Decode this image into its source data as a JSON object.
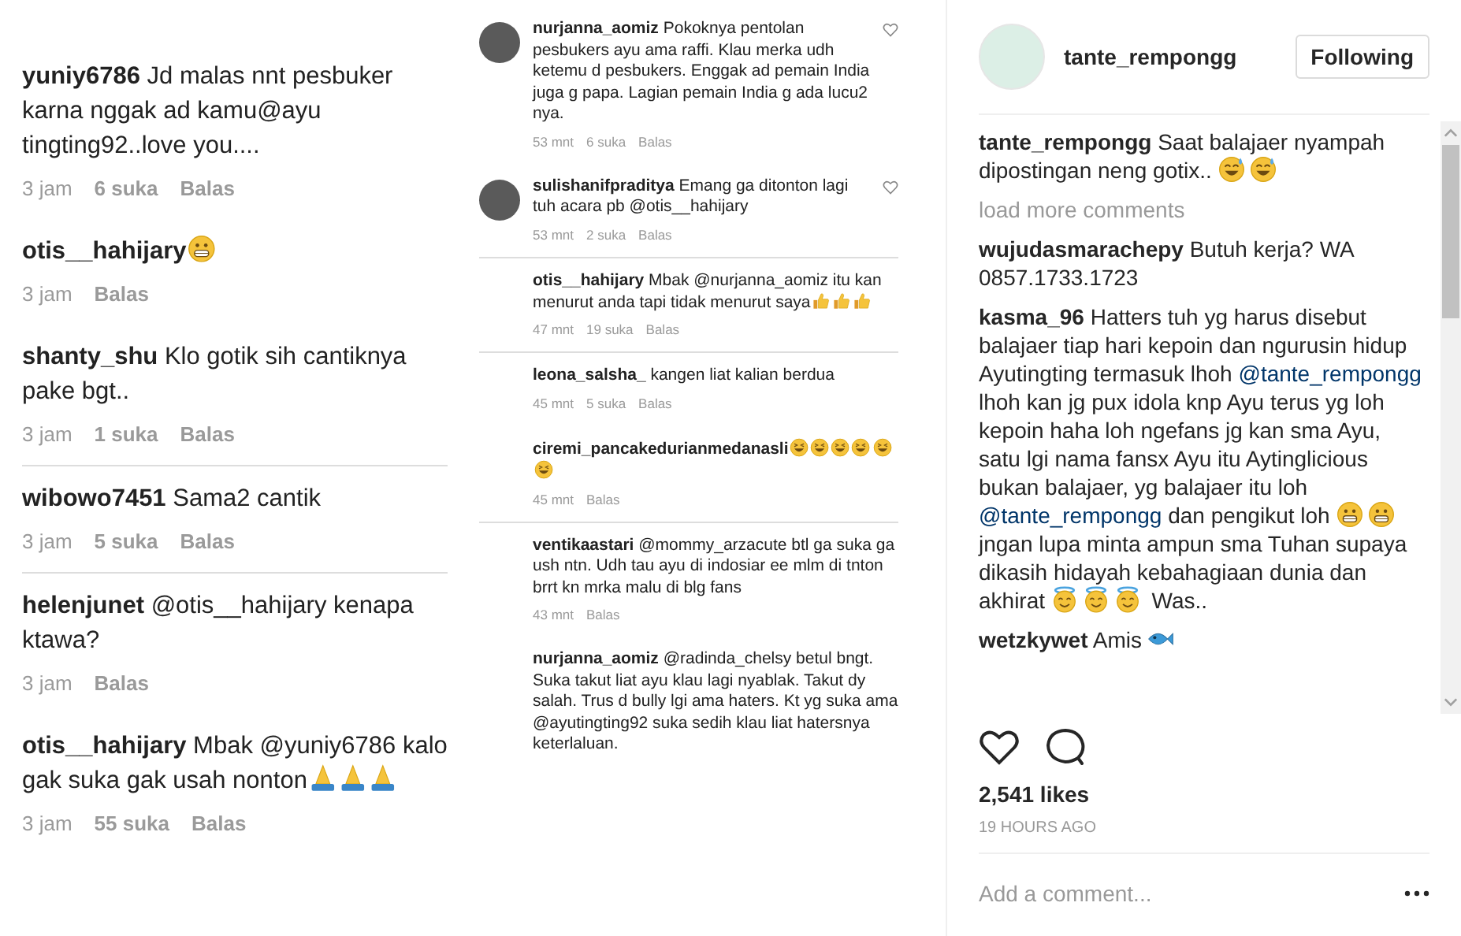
{
  "post_image": {
    "left_column": [
      {
        "text": "**yuniy6786** Jd malas nnt pesbuker karna nggak ad kamu@ayu tingting92..love you....",
        "meta": [
          "3 jam",
          "6 suka",
          "Balas"
        ],
        "divider": false
      },
      {
        "text": "**otis__hahijary**",
        "emoji": [
          {
            "kind": "grin"
          }
        ],
        "meta": [
          "3 jam",
          "Balas"
        ],
        "divider": false
      },
      {
        "text": "**shanty_shu** Klo gotik sih cantiknya pake bgt..",
        "meta": [
          "3 jam",
          "1 suka",
          "Balas"
        ],
        "divider": true
      },
      {
        "text": "**wibowo7451** Sama2 cantik",
        "meta": [
          "3 jam",
          "5 suka",
          "Balas"
        ],
        "divider": true
      },
      {
        "text": "**helenjunet** @otis__hahijary kenapa ktawa?",
        "meta": [
          "3 jam",
          "Balas"
        ],
        "divider": false
      },
      {
        "text": "**otis__hahijary** Mbak @yuniy6786 kalo gak suka gak usah nonton",
        "emoji": [
          {
            "kind": "pray"
          },
          {
            "kind": "pray"
          },
          {
            "kind": "pray"
          }
        ],
        "meta": [
          "3 jam",
          "55 suka",
          "Balas"
        ],
        "divider": false
      }
    ],
    "right_column": [
      {
        "avatar": true,
        "like_icon": true,
        "text": "**nurjanna_aomiz** Pokoknya pentolan pesbukers ayu ama raffi. Klau merka udh ketemu d pesbukers. Enggak ad pemain India juga g papa. Lagian pemain India g ada lucu2 nya.",
        "meta": [
          "53 mnt",
          "6 suka",
          "Balas"
        ],
        "divider": false
      },
      {
        "avatar": true,
        "like_icon": true,
        "text": "**sulishanifpraditya** Emang ga ditonton lagi tuh acara pb @otis__hahijary",
        "meta": [
          "53 mnt",
          "2 suka",
          "Balas"
        ],
        "divider": true
      },
      {
        "avatar": false,
        "like_icon": false,
        "text": "**otis__hahijary** Mbak @nurjanna_aomiz itu kan menurut anda tapi tidak menurut saya",
        "emoji": [
          {
            "kind": "thumb"
          },
          {
            "kind": "thumb"
          },
          {
            "kind": "thumb"
          }
        ],
        "meta": [
          "47 mnt",
          "19 suka",
          "Balas"
        ],
        "divider": true
      },
      {
        "avatar": false,
        "like_icon": false,
        "text": "**leona_salsha_** kangen liat kalian berdua",
        "meta": [
          "45 mnt",
          "5 suka",
          "Balas"
        ],
        "divider": false
      },
      {
        "avatar": false,
        "like_icon": false,
        "text": "**ciremi_pancakedurianmedanasli**",
        "emoji": [
          {
            "kind": "squint"
          },
          {
            "kind": "squint"
          },
          {
            "kind": "squint"
          },
          {
            "kind": "squint"
          },
          {
            "kind": "squint"
          },
          {
            "kind": "squint"
          }
        ],
        "meta": [
          "45 mnt",
          "Balas"
        ],
        "divider": true
      },
      {
        "avatar": false,
        "like_icon": false,
        "text": "**ventikaastari** @mommy_arzacute btl ga suka ga ush ntn. Udh tau ayu di indosiar ee mlm di tnton brrt kn mrka malu di blg fans",
        "meta": [
          "43 mnt",
          "Balas"
        ],
        "divider": false
      },
      {
        "avatar": false,
        "like_icon": false,
        "text": "**nurjanna_aomiz** @radinda_chelsy betul bngt. Suka takut liat ayu klau lagi nyablak. Takut dy salah. Trus d bully lgi ama haters. Kt yg suka ama @ayutingting92 suka sedih klau liat hatersnya keterlaluan.",
        "divider": false
      }
    ]
  },
  "header": {
    "username": "tante_rempongg",
    "follow_button": "Following"
  },
  "caption": {
    "user": "tante_rempongg",
    "segments": [
      {
        "kind": "text",
        "text": "Saat balajaer nyampah dipostingan neng gotix.. "
      },
      {
        "kind": "sweat"
      },
      {
        "kind": "sweat"
      }
    ]
  },
  "load_more": "load more comments",
  "comments": [
    {
      "user": "wujudasmarachepy",
      "segments": [
        {
          "kind": "text",
          "text": "Butuh kerja? WA 0857.1733.1723"
        }
      ]
    },
    {
      "user": "kasma_96",
      "segments": [
        {
          "kind": "text",
          "text": "Hatters tuh yg harus disebut balajaer tiap hari kepoin dan ngurusin hidup Ayutingting termasuk lhoh "
        },
        {
          "kind": "mention",
          "text": "@tante_rempongg"
        },
        {
          "kind": "text",
          "text": " lhoh kan jg pux idola knp Ayu terus yg loh kepoin haha loh ngefans jg kan sma Ayu, satu lgi nama fansx Ayu itu Aytinglicious bukan balajaer, yg balajaer itu loh "
        },
        {
          "kind": "mention",
          "text": "@tante_rempongg"
        },
        {
          "kind": "text",
          "text": " dan pengikut loh "
        },
        {
          "kind": "grin"
        },
        {
          "kind": "grin"
        },
        {
          "kind": "text",
          "text": " jngan lupa minta ampun sma Tuhan supaya dikasih hidayah kebahagiaan dunia dan akhirat "
        },
        {
          "kind": "halo"
        },
        {
          "kind": "halo"
        },
        {
          "kind": "halo"
        },
        {
          "kind": "text",
          "text": " Was.."
        }
      ]
    },
    {
      "user": "wetzkywet",
      "segments": [
        {
          "kind": "text",
          "text": "Amis "
        },
        {
          "kind": "fish"
        }
      ]
    }
  ],
  "likes": "2,541 likes",
  "time": "19 HOURS AGO",
  "comment_field": {
    "placeholder": "Add a comment..."
  }
}
